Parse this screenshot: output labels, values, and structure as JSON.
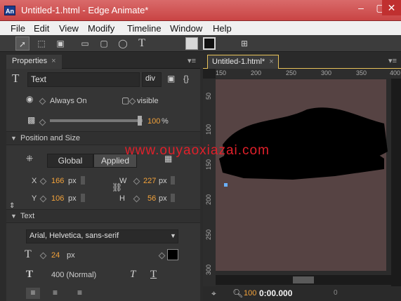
{
  "window": {
    "title": "Untitled-1.html - Edge Animate*",
    "app_icon": "An"
  },
  "menu": [
    "File",
    "Edit",
    "View",
    "Modify",
    "Timeline",
    "Window",
    "Help"
  ],
  "properties": {
    "tab_label": "Properties",
    "element_name": "Text",
    "tag": "div",
    "visibility": "Always On",
    "overflow": "visible",
    "opacity": "100",
    "opacity_unit": "%",
    "opacity_level": 1.0,
    "position_section": "Position and Size",
    "global_label": "Global",
    "applied_label": "Applied",
    "x_label": "X",
    "x": "166",
    "x_unit": "px",
    "y_label": "Y",
    "y": "106",
    "y_unit": "px",
    "w_label": "W",
    "w": "227",
    "w_unit": "px",
    "h_label": "H",
    "h": "56",
    "h_unit": "px",
    "text_section": "Text",
    "font_family": "Arial, Helvetica, sans-serif",
    "font_size": "24",
    "font_size_unit": "px",
    "font_weight": "400 (Normal)"
  },
  "stage": {
    "tab_label": "Untitled-1.html*",
    "ruler_top": [
      "150",
      "200",
      "250",
      "300",
      "350",
      "400"
    ],
    "ruler_left": [
      "50",
      "100",
      "150",
      "200",
      "250",
      "300"
    ],
    "zoom": "100",
    "time": "0:00.000",
    "time_offset": "0",
    "stage_color": "#564343"
  },
  "watermark": "www.ouyaoxiazai.com",
  "colors": {
    "accent": "#f3a23a",
    "title_bar": "#c94444"
  }
}
